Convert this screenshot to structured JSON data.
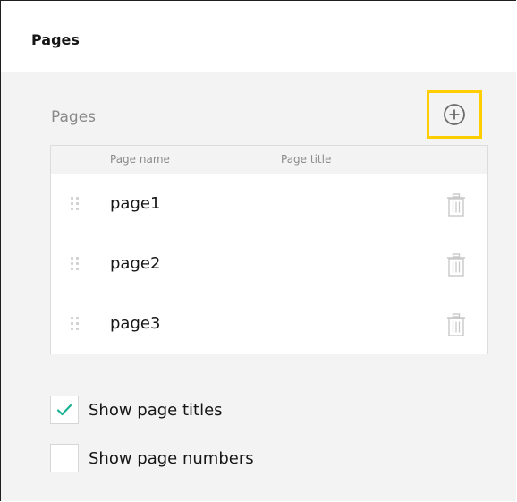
{
  "panel": {
    "title": "Pages"
  },
  "pages_section": {
    "title": "Pages",
    "add_icon": "plus-circle-icon",
    "add_highlight_color": "#ffcd00",
    "columns": [
      "Page name",
      "Page title"
    ],
    "rows": [
      {
        "name": "page1",
        "title": ""
      },
      {
        "name": "page2",
        "title": ""
      },
      {
        "name": "page3",
        "title": ""
      }
    ],
    "row_icons": {
      "drag": "drag-handle-icon",
      "delete": "trash-icon"
    }
  },
  "options": {
    "show_page_titles": {
      "label": "Show page titles",
      "checked": true
    },
    "show_page_numbers": {
      "label": "Show page numbers",
      "checked": false
    },
    "check_color": "#19b394"
  }
}
